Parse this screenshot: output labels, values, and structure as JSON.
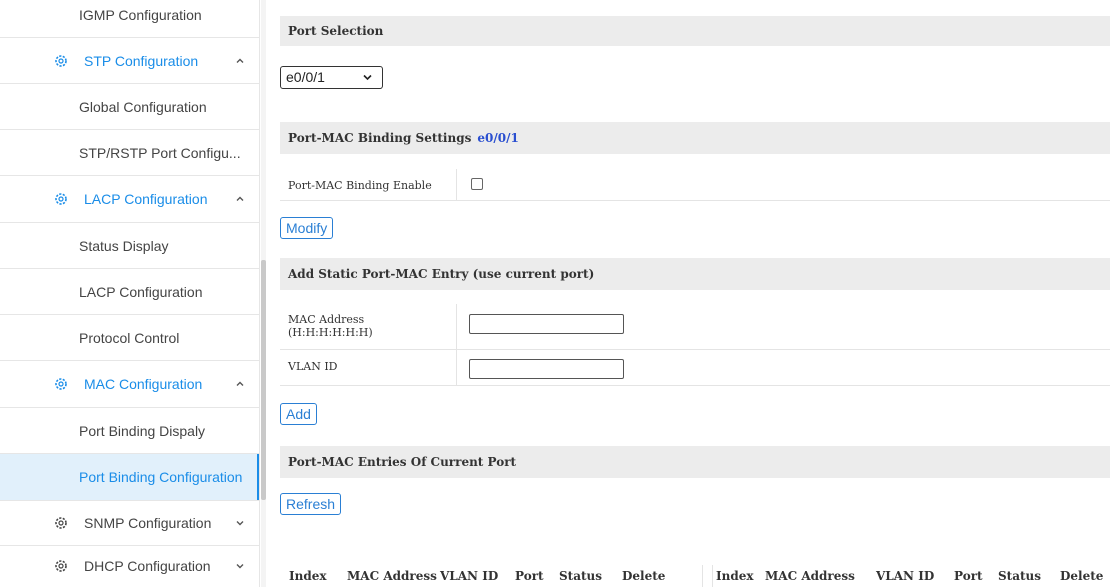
{
  "sidebar": {
    "igmp_config": "IGMP Configuration",
    "stp_group": "STP Configuration",
    "stp_global": "Global Configuration",
    "stp_port": "STP/RSTP Port Configu...",
    "lacp_group": "LACP Configuration",
    "lacp_status": "Status Display",
    "lacp_config": "LACP Configuration",
    "lacp_protocol": "Protocol Control",
    "mac_group": "MAC Configuration",
    "mac_port_display": "Port Binding Dispaly",
    "mac_port_config": "Port Binding Configuration",
    "snmp_group": "SNMP Configuration",
    "dhcp_group": "DHCP Configuration",
    "accent_color": "#1a8de8"
  },
  "main": {
    "port_selection_title": "Port Selection",
    "port_value": "e0/0/1",
    "binding_settings_title": "Port-MAC Binding Settings",
    "binding_settings_port": "e0/0/1",
    "binding_enable_label": "Port-MAC Binding Enable",
    "binding_enable_checked": false,
    "modify_label": "Modify",
    "add_entry_title": "Add Static Port-MAC Entry (use current port)",
    "mac_address_label": "MAC Address",
    "mac_address_hint": "(H:H:H:H:H:H)",
    "mac_address_value": "",
    "vlan_id_label": "VLAN ID",
    "vlan_id_value": "",
    "add_label": "Add",
    "entries_title": "Port-MAC Entries Of Current Port",
    "refresh_label": "Refresh",
    "table_headers": [
      "Index",
      "MAC Address",
      "VLAN ID",
      "Port",
      "Status",
      "Delete",
      "Index",
      "MAC Address",
      "VLAN ID",
      "Port",
      "Status",
      "Delete"
    ]
  }
}
